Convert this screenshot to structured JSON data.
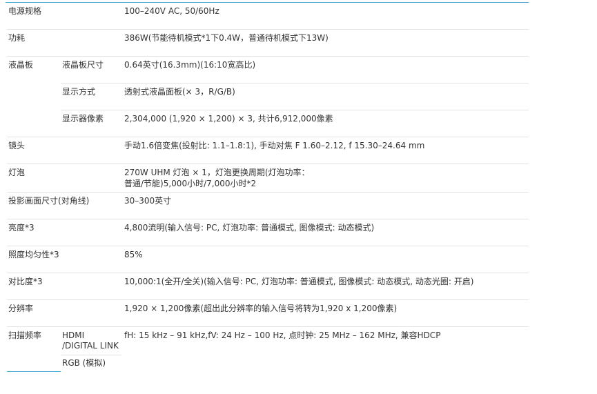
{
  "specs": {
    "power_supply": {
      "label": "电源规格",
      "value": "100–240V AC, 50/60Hz"
    },
    "power_consumption": {
      "label": "功耗",
      "value": "386W(节能待机模式*1下0.4W，普通待机模式下13W)"
    },
    "lcd": {
      "label": "液晶板",
      "size": {
        "label": "液晶板尺寸",
        "value": "0.64英寸(16.3mm)(16:10宽高比)"
      },
      "display_method": {
        "label": "显示方式",
        "value": "透射式液晶面板(× 3，R/G/B)"
      },
      "pixels": {
        "label": "显示器像素",
        "value": "2,304,000 (1,920 × 1,200) × 3, 共计6,912,000像素"
      }
    },
    "lens": {
      "label": "镜头",
      "value": "手动1.6倍变焦(投射比: 1.1–1.8:1), 手动对焦 F 1.60–2.12, f 15.30–24.64 mm"
    },
    "lamp": {
      "label": "灯泡",
      "value_line1": "270W UHM 灯泡 × 1，灯泡更换周期(灯泡功率：",
      "value_line2": "普通/节能)5,000小时/7,000小时*2"
    },
    "screen_size": {
      "label": "投影画面尺寸(对角线)",
      "value": "30–300英寸"
    },
    "brightness": {
      "label": "亮度*3",
      "value": "4,800流明(输入信号: PC, 灯泡功率: 普通模式, 图像模式: 动态模式)"
    },
    "uniformity": {
      "label": "照度均匀性*3",
      "value": "85%"
    },
    "contrast": {
      "label": "对比度*3",
      "value": "10,000:1(全开/全关)(输入信号: PC, 灯泡功率: 普通模式, 图像模式: 动态模式, 动态光圈: 开启)"
    },
    "resolution": {
      "label": "分辨率",
      "value": "1,920 × 1,200像素(超出此分辨率的输入信号将转为1,920 x 1,200像素)"
    },
    "scan_frequency": {
      "label": "扫描频率",
      "hdmi": {
        "label": "HDMI /DIGITAL LINK",
        "value": "fH: 15 kHz – 91 kHz,fV: 24 Hz – 100 Hz, 点时钟: 25 MHz – 162 MHz, 兼容HDCP"
      },
      "rgb": {
        "label": "RGB (模拟)"
      }
    }
  }
}
